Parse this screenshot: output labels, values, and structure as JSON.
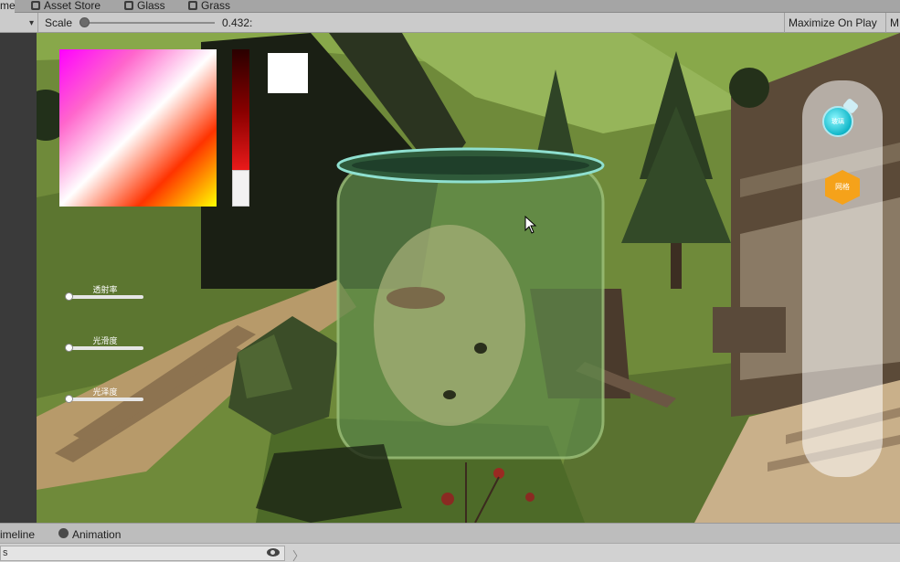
{
  "tabs": [
    {
      "label": "me",
      "active": true
    },
    {
      "label": "Asset Store",
      "icon": "bag-icon"
    },
    {
      "label": "Glass",
      "icon": "scene-icon"
    },
    {
      "label": "Grass",
      "icon": "scene-icon"
    }
  ],
  "toolbar": {
    "dropdown_icon": "▾",
    "scale_label": "Scale",
    "scale_value": "0.432:",
    "scale_level": 0.0,
    "maximize_label": "Maximize On Play",
    "mute_label": "M"
  },
  "game_ui": {
    "sliders": [
      {
        "label": "透射率",
        "value": 0.0
      },
      {
        "label": "光滑度",
        "value": 0.0
      },
      {
        "label": "光泽度",
        "value": 0.0
      }
    ],
    "swatch_color": "#ffffff",
    "potion_label": "玻璃",
    "hex_label": "网格"
  },
  "bottom": {
    "timeline_label": "imeline",
    "animation_label": "Animation",
    "status_text": "s"
  },
  "colors": {
    "editor_bg": "#cbcbcb",
    "grass": "#6f8a3a",
    "glass_tint": "#5f8a4a"
  }
}
